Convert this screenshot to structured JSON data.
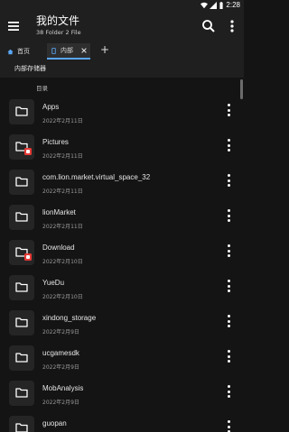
{
  "status_bar": {
    "time": "2:28"
  },
  "app_bar": {
    "title": "我的文件",
    "subtitle": "38 Folder 2 File"
  },
  "tabs": [
    {
      "label": "首页"
    },
    {
      "label": "内部"
    }
  ],
  "add_tab": "+",
  "breadcrumb": "内部存储器",
  "section_label": "目录",
  "files": [
    {
      "name": "Apps",
      "date": "2022年2月11日",
      "badge": false
    },
    {
      "name": "Pictures",
      "date": "2022年2月11日",
      "badge": true
    },
    {
      "name": "com.lion.market.virtual_space_32",
      "date": "2022年2月11日",
      "badge": false
    },
    {
      "name": "lionMarket",
      "date": "2022年2月11日",
      "badge": false
    },
    {
      "name": "Download",
      "date": "2022年2月10日",
      "badge": true
    },
    {
      "name": "YueDu",
      "date": "2022年2月10日",
      "badge": false
    },
    {
      "name": "xindong_storage",
      "date": "2022年2月9日",
      "badge": false
    },
    {
      "name": "ucgamesdk",
      "date": "2022年2月9日",
      "badge": false
    },
    {
      "name": "MobAnalysis",
      "date": "2022年2月9日",
      "badge": false
    },
    {
      "name": "guopan",
      "date": "",
      "badge": false
    }
  ],
  "colors": {
    "accent": "#5aa7f5",
    "background": "#141414",
    "bar": "#1f1f1f",
    "badge": "#e53935"
  },
  "icons": [
    "menu-icon",
    "search-icon",
    "more-vert-icon",
    "home-icon",
    "phone-icon",
    "close-icon",
    "folder-icon"
  ]
}
